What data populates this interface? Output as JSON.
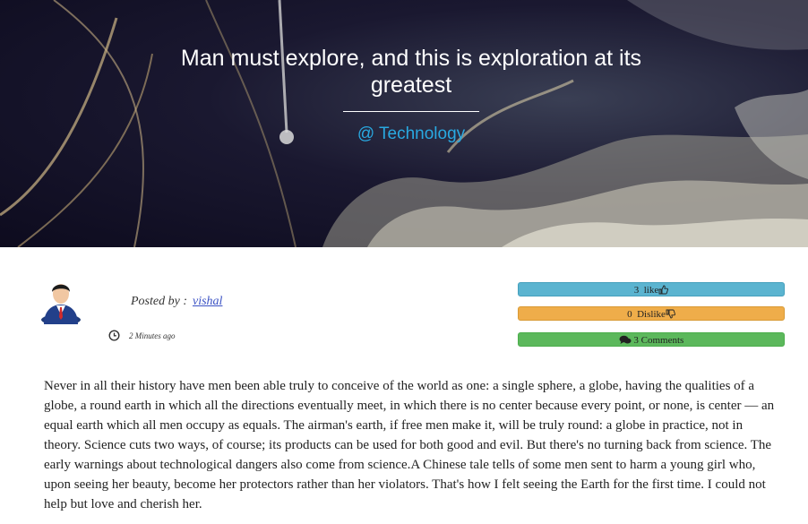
{
  "hero": {
    "title": "Man must explore, and this is exploration at its greatest",
    "category": "@ Technology"
  },
  "meta": {
    "posted_by_label": "Posted by :",
    "author": "vishal",
    "time_ago": "2 Minutes ago"
  },
  "actions": {
    "like_count": "3",
    "like_label": "like",
    "dislike_count": "0",
    "dislike_label": "Dislike",
    "comments_label": "3 Comments"
  },
  "article": {
    "body": "Never in all their history have men been able truly to conceive of the world as one: a single sphere, a globe, having the qualities of a globe, a round earth in which all the directions eventually meet, in which there is no center because every point, or none, is center — an equal earth which all men occupy as equals. The airman's earth, if free men make it, will be truly round: a globe in practice, not in theory. Science cuts two ways, of course; its products can be used for both good and evil. But there's no turning back from science. The early warnings about technological dangers also come from science.A Chinese tale tells of some men sent to harm a young girl who, upon seeing her beauty, become her protectors rather than her violators. That's how I felt seeing the Earth for the first time. I could not help but love and cherish her."
  },
  "colors": {
    "category": "#29a9e1",
    "author": "#3b52c4",
    "like": "#5bb4d0",
    "dislike": "#efad4a",
    "comments": "#5cb85c"
  },
  "icons": {
    "like": "thumbs-up-icon",
    "dislike": "thumbs-down-icon",
    "comments": "comments-icon",
    "time": "clock-icon"
  }
}
